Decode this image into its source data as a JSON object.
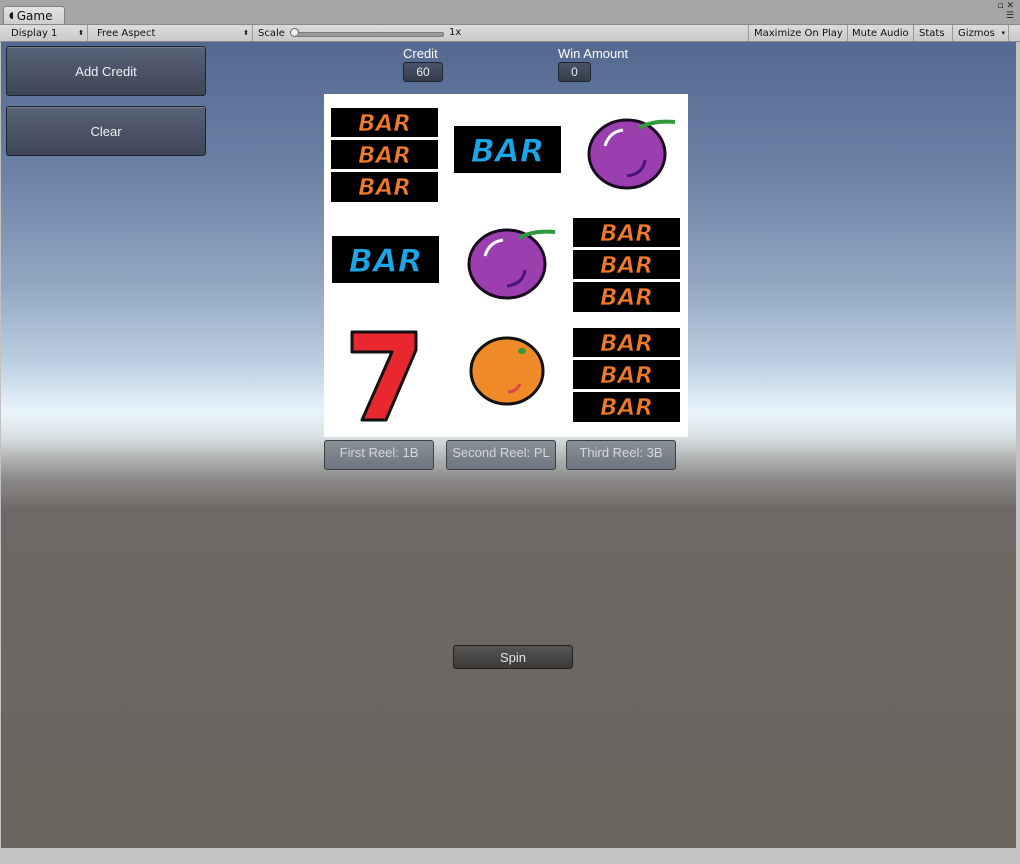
{
  "editor": {
    "tab_title": "Game",
    "display_label": "Display 1",
    "aspect_label": "Free Aspect",
    "scale_label": "Scale",
    "scale_value": "1x",
    "maximize_label": "Maximize On Play",
    "mute_label": "Mute Audio",
    "stats_label": "Stats",
    "gizmos_label": "Gizmos"
  },
  "game": {
    "add_credit_label": "Add Credit",
    "clear_label": "Clear",
    "credit_label": "Credit",
    "credit_value": "60",
    "win_label": "Win Amount",
    "win_value": "0",
    "reel_buttons": [
      "First Reel: 1B",
      "Second Reel: PL",
      "Third Reel: 3B"
    ],
    "spin_label": "Spin",
    "bar_text": "BAR",
    "seven_text": "7",
    "grid": [
      [
        "triple-bar",
        "single-bar",
        "plum"
      ],
      [
        "single-bar",
        "plum",
        "triple-bar"
      ],
      [
        "seven",
        "orange",
        "triple-bar"
      ]
    ]
  },
  "colors": {
    "bar_orange": "#f07a2a",
    "bar_blue": "#1aa6e8",
    "plum": "#9b3fb0",
    "orange": "#f08a28",
    "seven_red": "#e8282e",
    "stem_green": "#2e9a3a"
  }
}
